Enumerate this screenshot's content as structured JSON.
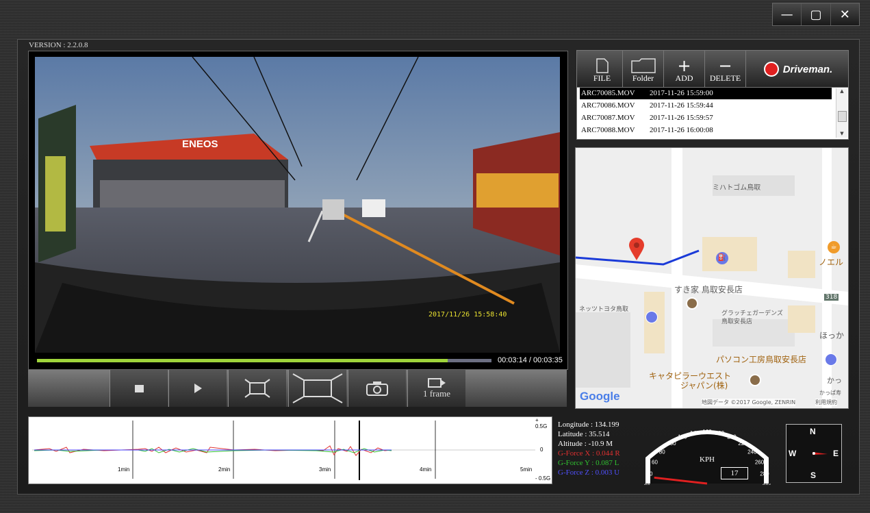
{
  "window": {
    "minimize": "—",
    "maximize": "▢",
    "close": "✕"
  },
  "version": "VERSION : 2.2.0.8",
  "video": {
    "overlay_timestamp": "2017/11/26 15:58:40",
    "sign_eneos": "ENEOS",
    "progress": 0.903,
    "timecode": "00:03:14 / 00:03:35"
  },
  "controls": {
    "frame_label": "1 frame"
  },
  "toolbar": {
    "file": "FILE",
    "folder": "Folder",
    "add": "ADD",
    "delete": "DELETE",
    "brand": "Driveman."
  },
  "files": [
    {
      "name": "ARC70085.MOV",
      "date": "2017-11-26 15:59:00",
      "selected": true
    },
    {
      "name": "ARC70086.MOV",
      "date": "2017-11-26 15:59:44"
    },
    {
      "name": "ARC70087.MOV",
      "date": "2017-11-26 15:59:57"
    },
    {
      "name": "ARC70088.MOV",
      "date": "2017-11-26 16:00:08"
    }
  ],
  "map": {
    "labels": [
      "ミハトゴム鳥取",
      "すき家 鳥取安長店",
      "ネッツトヨタ鳥取",
      "グラッチェガーデンズ",
      "鳥取安長店",
      "パソコン工房鳥取安長店",
      "キャタピラーウエスト",
      "ジャパン(株)",
      "ノエル",
      "ほっか",
      "かっ",
      "かっぱ寿",
      "318"
    ],
    "google": "Google",
    "attribution": "地図データ ©2017 Google, ZENRIN",
    "terms": "利用規約"
  },
  "graph": {
    "top": "+ 0.5G",
    "zero": "0",
    "bottom": "- 0.5G",
    "ticks": [
      "1min",
      "2min",
      "3min",
      "4min",
      "5min"
    ]
  },
  "telemetry": {
    "longitude": "Longitude : 134.199",
    "latitude": "Latitude  : 35.514",
    "altitude": "Altitude  : -10.9 M",
    "gx": "G-Force X : 0.044 R",
    "gy": "G-Force Y : 0.087 L",
    "gz": "G-Force Z : 0.003 U"
  },
  "speedometer": {
    "unit": "KPH",
    "speed": "17",
    "ticks": [
      "20",
      "40",
      "60",
      "80",
      "100",
      "120",
      "140",
      "160",
      "180",
      "200",
      "220",
      "240",
      "260",
      "280",
      "300"
    ]
  },
  "compass": {
    "n": "N",
    "e": "E",
    "s": "S",
    "w": "W"
  },
  "colors": {
    "accent_progress": "#9fd43b",
    "gx": "#e03030",
    "gy": "#30c030",
    "gz": "#4040ff"
  }
}
